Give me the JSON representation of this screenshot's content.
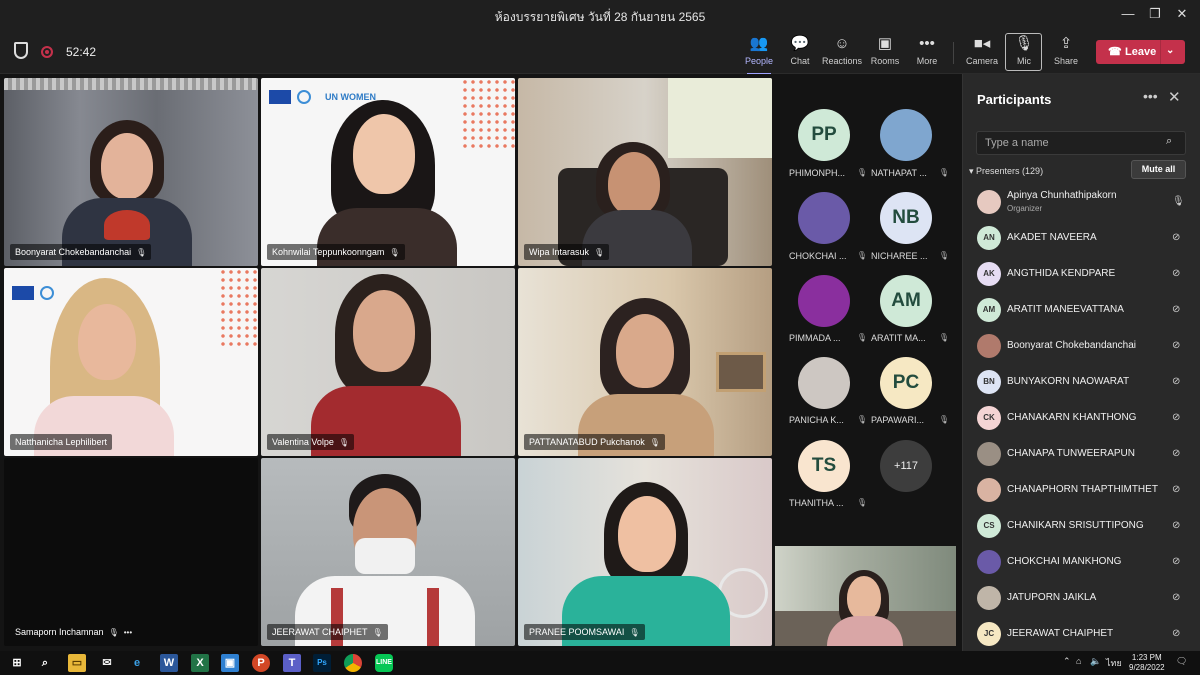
{
  "window": {
    "title": "ห้องบรรยายพิเศษ วันที่ 28 กันยายน 2565"
  },
  "meeting": {
    "timer": "52:42"
  },
  "toolbar": {
    "people": "People",
    "chat": "Chat",
    "reactions": "Reactions",
    "rooms": "Rooms",
    "more": "More",
    "camera": "Camera",
    "mic": "Mic",
    "share": "Share",
    "leave": "Leave"
  },
  "tiles": [
    {
      "name": "Boonyarat Chokebandanchai"
    },
    {
      "name": "Kohnwilai Teppunkoonngam"
    },
    {
      "name": "Wipa Intarasuk"
    },
    {
      "name": "Natthanicha Lephilibert"
    },
    {
      "name": "Valentina Volpe"
    },
    {
      "name": "PATTANATABUD Pukchanok"
    },
    {
      "name": "Samaporn Inchamnan"
    },
    {
      "name": "JEERAWAT CHAIPHET"
    },
    {
      "name": "PRANEE POOMSAWAI"
    }
  ],
  "tile_logo": {
    "un_women": "UN WOMEN"
  },
  "rail": {
    "avatars": [
      {
        "initials": "PP",
        "label": "PHIMONPH...",
        "color": "#cfe9d7"
      },
      {
        "initials": "",
        "label": "NATHAPAT ...",
        "color": "#7fa6cf"
      },
      {
        "initials": "",
        "label": "CHOKCHAI ...",
        "color": "#6a5aa8"
      },
      {
        "initials": "NB",
        "label": "NICHAREE ...",
        "color": "#dde4f4"
      },
      {
        "initials": "",
        "label": "PIMMADA ...",
        "color": "#8a2f9e"
      },
      {
        "initials": "AM",
        "label": "ARATIT MA...",
        "color": "#cfe9d7"
      },
      {
        "initials": "",
        "label": "PANICHA K...",
        "color": "#cdc7c2"
      },
      {
        "initials": "PC",
        "label": "PAPAWARI...",
        "color": "#f6e8c3"
      },
      {
        "initials": "TS",
        "label": "THANITHA ...",
        "color": "#f9e5cf"
      },
      {
        "initials": "+117",
        "label": "",
        "color": "#3d3d3d"
      }
    ]
  },
  "participants": {
    "title": "Participants",
    "search_placeholder": "Type a name",
    "presenters_label": "Presenters (129)",
    "mute_all": "Mute all",
    "organizer_role": "Organizer",
    "list": [
      {
        "initials": "",
        "name": "Apinya Chunhathipakorn",
        "color": "#e6c9c0",
        "mic": "on"
      },
      {
        "initials": "AN",
        "name": "AKADET NAVEERA",
        "color": "#cfe9d7"
      },
      {
        "initials": "AK",
        "name": "ANGTHIDA KENDPARE",
        "color": "#e6dcf3"
      },
      {
        "initials": "AM",
        "name": "ARATIT MANEEVATTANA",
        "color": "#cfe9d7"
      },
      {
        "initials": "",
        "name": "Boonyarat Chokebandanchai",
        "color": "#b07a6c"
      },
      {
        "initials": "BN",
        "name": "BUNYAKORN NAOWARAT",
        "color": "#dde4f4"
      },
      {
        "initials": "CK",
        "name": "CHANAKARN KHANTHONG",
        "color": "#f4d4d4"
      },
      {
        "initials": "",
        "name": "CHANAPA TUNWEERAPUN",
        "color": "#9a8f84"
      },
      {
        "initials": "",
        "name": "CHANAPHORN THAPTHIMTHET",
        "color": "#d9b3a2"
      },
      {
        "initials": "CS",
        "name": "CHANIKARN SRISUTTIPONG",
        "color": "#cfe9d7"
      },
      {
        "initials": "",
        "name": "CHOKCHAI MANKHONG",
        "color": "#6a5aa8"
      },
      {
        "initials": "",
        "name": "JATUPORN JAIKLA",
        "color": "#bfb5a8"
      },
      {
        "initials": "JC",
        "name": "JEERAWAT CHAIPHET",
        "color": "#f6e8c3"
      }
    ]
  },
  "taskbar": {
    "time": "1:23 PM",
    "date": "9/28/2022",
    "lang": "ไทย"
  },
  "colors": {
    "accent": "#9ea2ff",
    "leave": "#c4314b"
  }
}
